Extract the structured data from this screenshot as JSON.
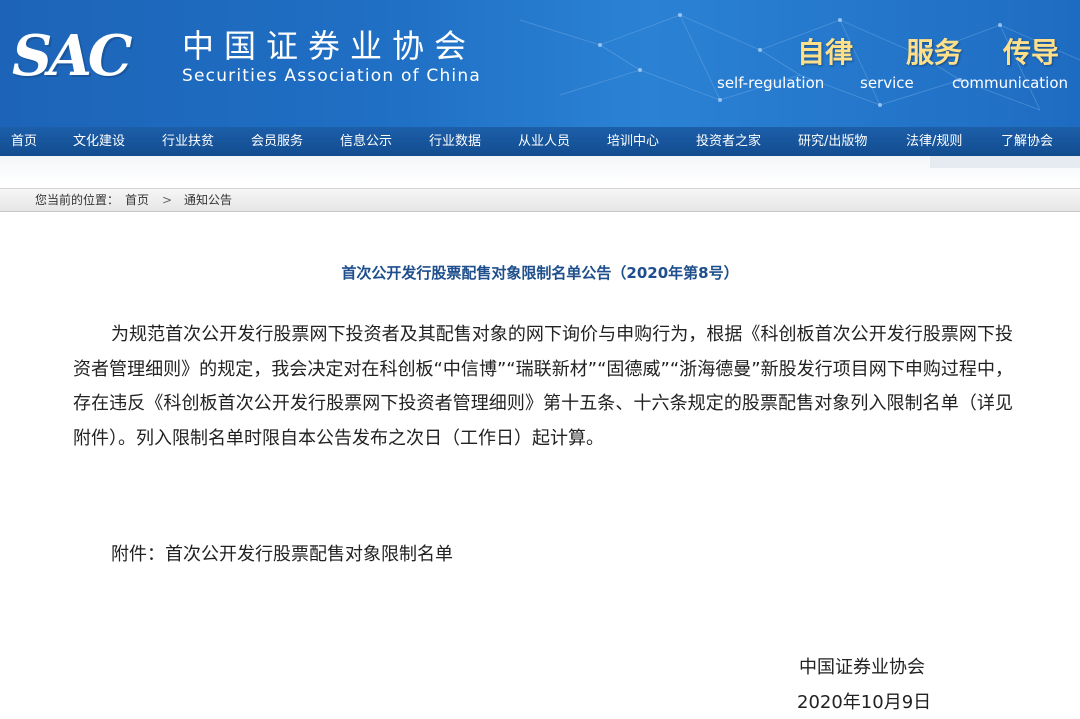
{
  "header": {
    "logo_text": "SAC",
    "org_name_cn": "中国证券业协会",
    "org_name_en": "Securities Association of China",
    "slogans": [
      {
        "cn": "自律",
        "en": "self-regulation"
      },
      {
        "cn": "服务",
        "en": "service"
      },
      {
        "cn": "传导",
        "en": "communication"
      }
    ]
  },
  "nav": {
    "items": [
      {
        "label": "首页"
      },
      {
        "label": "文化建设"
      },
      {
        "label": "行业扶贫"
      },
      {
        "label": "会员服务"
      },
      {
        "label": "信息公示"
      },
      {
        "label": "行业数据"
      },
      {
        "label": "从业人员"
      },
      {
        "label": "培训中心"
      },
      {
        "label": "投资者之家"
      },
      {
        "label": "研究/出版物"
      },
      {
        "label": "法律/规则"
      },
      {
        "label": "了解协会"
      }
    ]
  },
  "breadcrumb": {
    "prefix": "您当前的位置：",
    "home": "首页",
    "separator": ">",
    "current": "通知公告"
  },
  "article": {
    "title": "首次公开发行股票配售对象限制名单公告（2020年第8号）",
    "body": "为规范首次公开发行股票网下投资者及其配售对象的网下询价与申购行为，根据《科创板首次公开发行股票网下投资者管理细则》的规定，我会决定对在科创板“中信博”“瑞联新材”“固德威”“浙海德曼”新股发行项目网下申购过程中，存在违反《科创板首次公开发行股票网下投资者管理细则》第十五条、十六条规定的股票配售对象列入限制名单（详见附件）。列入限制名单时限自本公告发布之次日（工作日）起计算。",
    "attachment_prefix": "附件：",
    "attachment_link": "首次公开发行股票配售对象限制名单",
    "org": "中国证券业协会",
    "date": "2020年10月9日"
  },
  "colors": {
    "banner": "#1f6fc4",
    "nav": "#124c8f",
    "title": "#1e4f8c",
    "slogan": "#ffe08a"
  }
}
